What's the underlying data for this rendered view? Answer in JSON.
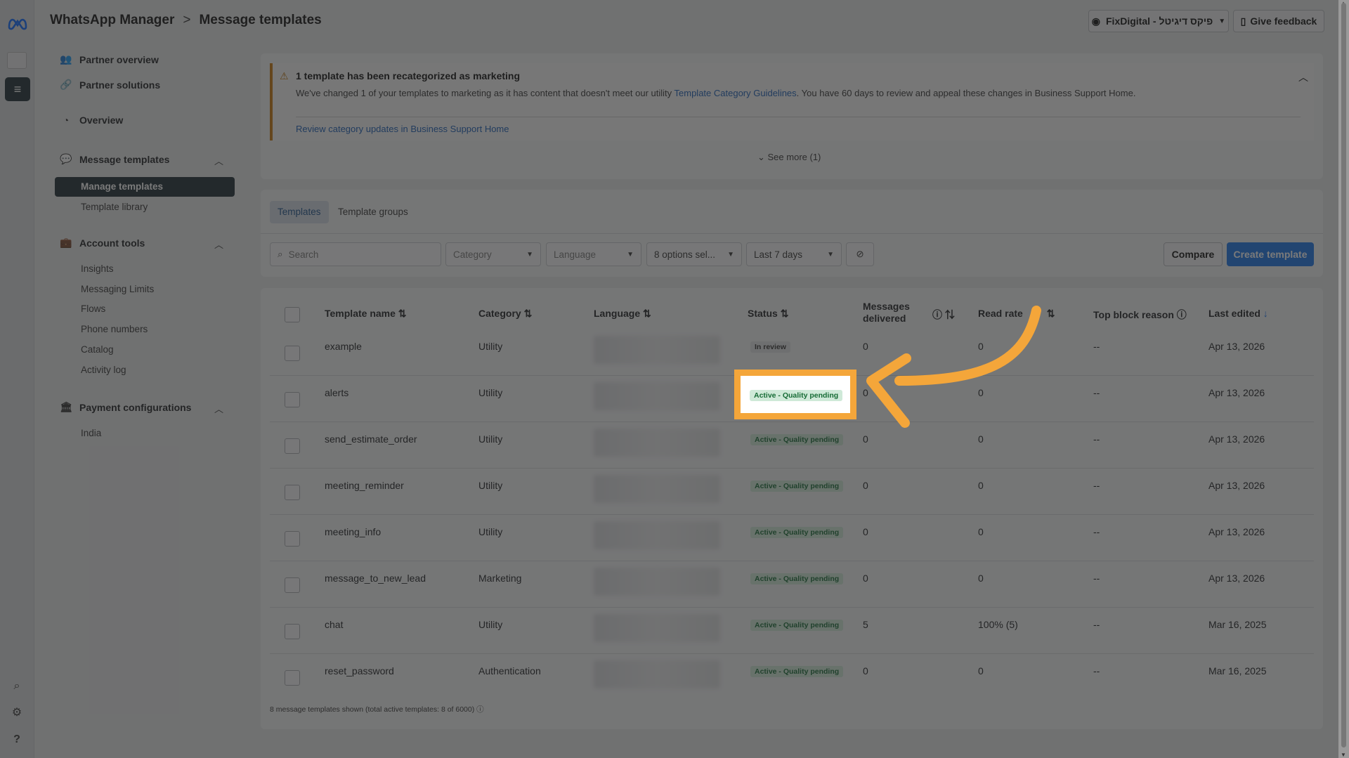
{
  "header": {
    "app_title": "WhatsApp Manager",
    "separator": ">",
    "page_title": "Message templates",
    "account_label": "FixDigital - פיקס דיגיטל",
    "feedback_label": "Give feedback"
  },
  "sidebar": {
    "partner_overview": "Partner overview",
    "partner_solutions": "Partner solutions",
    "overview": "Overview",
    "message_templates": "Message templates",
    "manage_templates": "Manage templates",
    "template_library": "Template library",
    "account_tools": "Account tools",
    "insights": "Insights",
    "messaging_limits": "Messaging Limits",
    "flows": "Flows",
    "phone_numbers": "Phone numbers",
    "catalog": "Catalog",
    "activity_log": "Activity log",
    "payment_configurations": "Payment configurations",
    "india": "India"
  },
  "alert": {
    "title": "1 template has been recategorized as marketing",
    "body_prefix": "We've changed 1 of your templates to marketing as it has content that doesn't meet our utility ",
    "body_link": "Template Category Guidelines",
    "body_suffix": ". You have 60 days to review and appeal these changes in Business Support Home.",
    "review_link": "Review category updates in Business Support Home",
    "see_more": "See more (1)"
  },
  "tabs": {
    "templates": "Templates",
    "template_groups": "Template groups"
  },
  "filters": {
    "search_placeholder": "Search",
    "category": "Category",
    "language": "Language",
    "status": "8 options sel...",
    "date_range": "Last 7 days",
    "compare": "Compare",
    "create": "Create template"
  },
  "table": {
    "headers": {
      "name": "Template name",
      "category": "Category",
      "language": "Language",
      "status": "Status",
      "delivered": "Messages delivered",
      "read_rate": "Read rate",
      "block_reason": "Top block reason",
      "last_edited": "Last edited"
    },
    "rows": [
      {
        "name": "example",
        "category": "Utility",
        "status": "In review",
        "delivered": "0",
        "read_rate": "0",
        "block_reason": "--",
        "last_edited": "Apr 13, 2026"
      },
      {
        "name": "alerts",
        "category": "Utility",
        "status": "Active - Quality pending",
        "delivered": "0",
        "read_rate": "0",
        "block_reason": "--",
        "last_edited": "Apr 13, 2026"
      },
      {
        "name": "send_estimate_order",
        "category": "Utility",
        "status": "Active - Quality pending",
        "delivered": "0",
        "read_rate": "0",
        "block_reason": "--",
        "last_edited": "Apr 13, 2026"
      },
      {
        "name": "meeting_reminder",
        "category": "Utility",
        "status": "Active - Quality pending",
        "delivered": "0",
        "read_rate": "0",
        "block_reason": "--",
        "last_edited": "Apr 13, 2026"
      },
      {
        "name": "meeting_info",
        "category": "Utility",
        "status": "Active - Quality pending",
        "delivered": "0",
        "read_rate": "0",
        "block_reason": "--",
        "last_edited": "Apr 13, 2026"
      },
      {
        "name": "message_to_new_lead",
        "category": "Marketing",
        "status": "Active - Quality pending",
        "delivered": "0",
        "read_rate": "0",
        "block_reason": "--",
        "last_edited": "Apr 13, 2026"
      },
      {
        "name": "chat",
        "category": "Utility",
        "status": "Active - Quality pending",
        "delivered": "5",
        "read_rate": "100% (5)",
        "block_reason": "--",
        "last_edited": "Mar 16, 2025"
      },
      {
        "name": "reset_password",
        "category": "Authentication",
        "status": "Active - Quality pending",
        "delivered": "0",
        "read_rate": "0",
        "block_reason": "--",
        "last_edited": "Mar 16, 2025"
      }
    ],
    "footer": "8 message templates shown (total active templates: 8 of 6000)"
  },
  "colors": {
    "highlight": "#f4a63a",
    "primary_button": "#1a73e8",
    "active_nav": "#1c2b33",
    "badge_green_bg": "#cfe9d8",
    "badge_green_text": "#166b35"
  }
}
